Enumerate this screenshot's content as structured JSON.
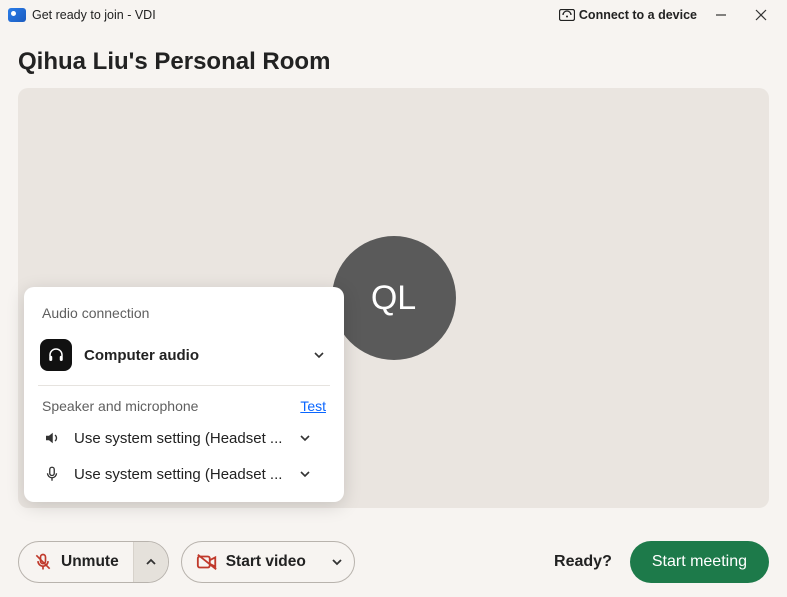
{
  "titlebar": {
    "title": "Get ready to join - VDI",
    "connect_label": "Connect to a device"
  },
  "room": {
    "title": "Qihua Liu's Personal Room",
    "avatar_initials": "QL"
  },
  "popover": {
    "heading": "Audio connection",
    "audio_option": "Computer audio",
    "sub_heading": "Speaker and microphone",
    "test_link": "Test",
    "speaker": "Use system setting (Headset ...",
    "microphone": "Use system setting (Headset ..."
  },
  "controls": {
    "unmute": "Unmute",
    "start_video": "Start video",
    "ready_prompt": "Ready?",
    "start_meeting": "Start meeting"
  }
}
